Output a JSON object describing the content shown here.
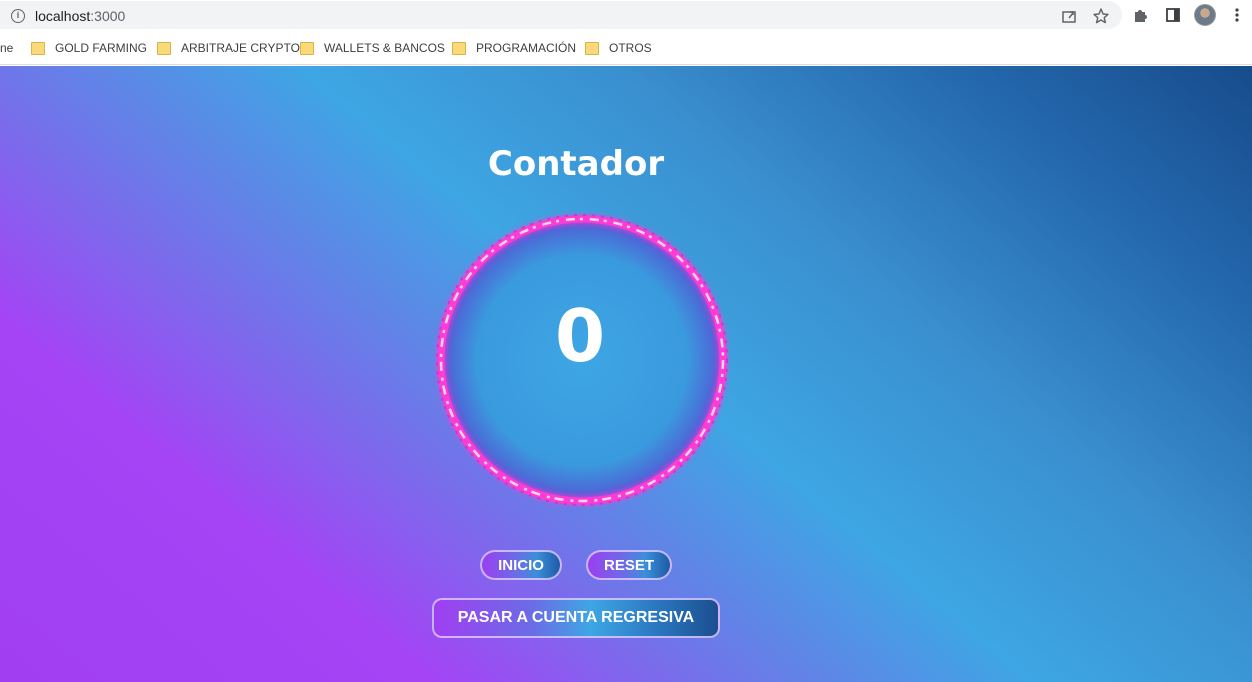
{
  "browser": {
    "url_host": "localhost",
    "url_port": ":3000",
    "icons": {
      "info": "info-icon",
      "share": "share-icon",
      "bookmark": "star-icon",
      "extensions": "puzzle-icon",
      "sidepanel": "sidepanel-icon",
      "profile": "avatar",
      "menu": "kebab-menu-icon"
    }
  },
  "bookmarks": {
    "partial_label": "ne",
    "items": [
      {
        "label": "GOLD FARMING"
      },
      {
        "label": "ARBITRAJE CRYPTO"
      },
      {
        "label": "WALLETS & BANCOS"
      },
      {
        "label": "PROGRAMACIÓN"
      },
      {
        "label": "OTROS"
      }
    ]
  },
  "app": {
    "title": "Contador",
    "counter_value": "0",
    "buttons": {
      "start": "INICIO",
      "reset": "RESET",
      "countdown": "PASAR A CUENTA REGRESIVA"
    },
    "colors": {
      "gradient_purple": "#a13ef2",
      "gradient_cyan": "#3ea6e4",
      "gradient_navy": "#174c8c",
      "ring_pink": "#ff3ad6"
    }
  }
}
